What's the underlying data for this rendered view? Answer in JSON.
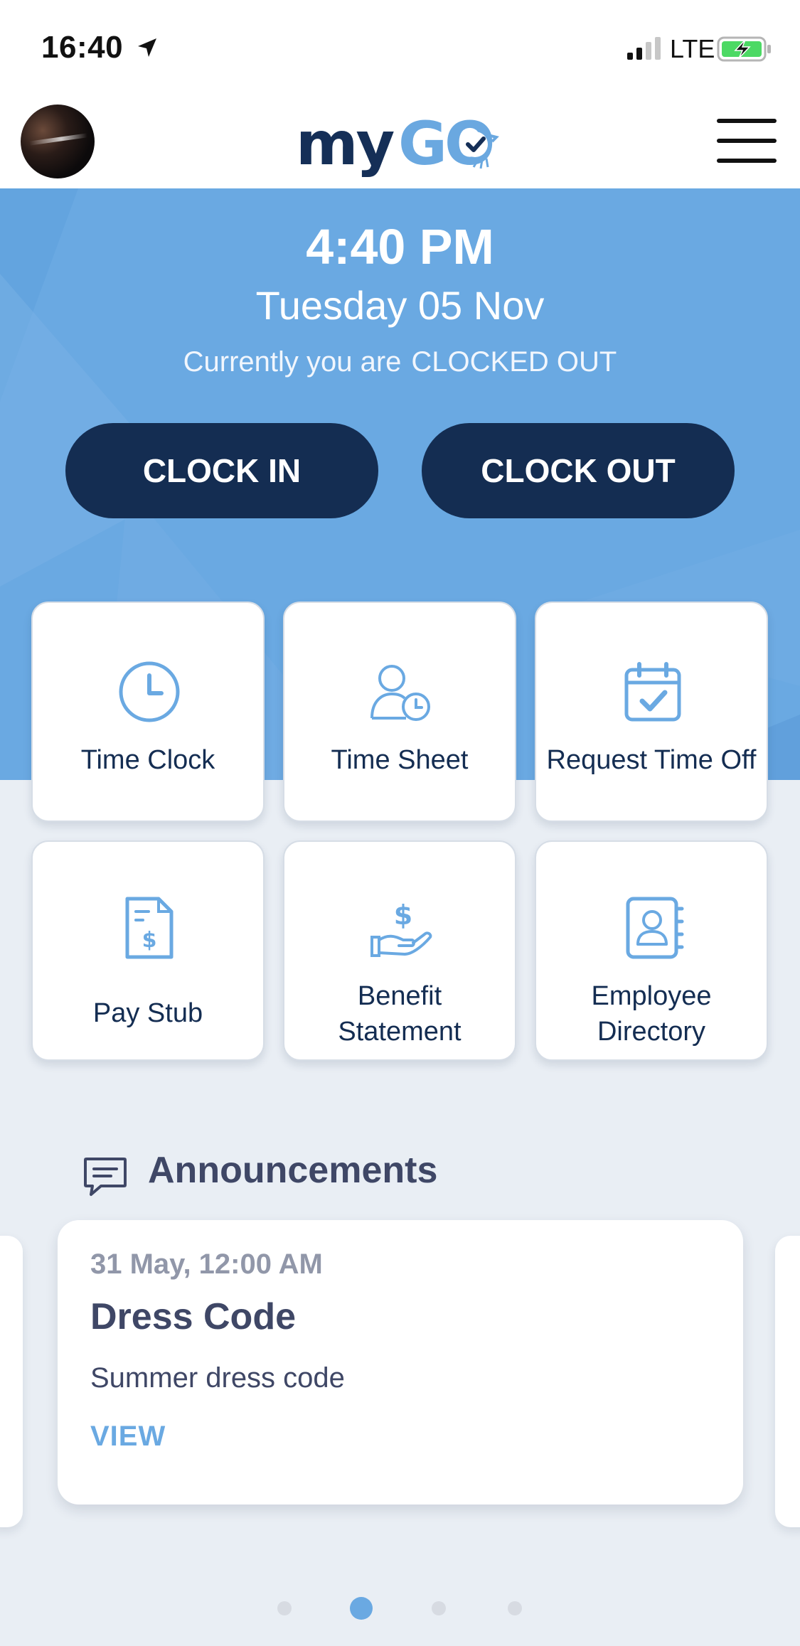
{
  "status_bar": {
    "time": "16:40",
    "network": "LTE",
    "icons": [
      "location-arrow-icon",
      "signal-icon",
      "battery-charging-icon"
    ]
  },
  "header": {
    "logo_part1": "my",
    "logo_part2": "GO",
    "icons": [
      "avatar",
      "hamburger-menu-icon"
    ]
  },
  "hero": {
    "time": "4:40 PM",
    "date": "Tuesday 05 Nov",
    "status_prefix": "Currently you are",
    "status_value": "CLOCKED OUT",
    "clock_in_label": "CLOCK IN",
    "clock_out_label": "CLOCK OUT"
  },
  "tiles": [
    {
      "label": "Time Clock",
      "icon": "clock-icon"
    },
    {
      "label": "Time Sheet",
      "icon": "user-clock-icon"
    },
    {
      "label": "Request Time Off",
      "icon": "calendar-check-icon"
    },
    {
      "label": "Pay Stub",
      "icon": "document-dollar-icon"
    },
    {
      "label_line1": "Benefit",
      "label_line2": "Statement",
      "icon": "hand-dollar-icon"
    },
    {
      "label_line1": "Employee",
      "label_line2": "Directory",
      "icon": "contact-book-icon"
    }
  ],
  "announcements": {
    "heading": "Announcements",
    "icon": "chat-bubble-icon",
    "card": {
      "date": "31 May, 12:00 AM",
      "title": "Dress Code",
      "body": "Summer dress code",
      "action": "VIEW"
    },
    "pager": {
      "total": 4,
      "active_index": 1
    }
  },
  "colors": {
    "primary_dark": "#142d52",
    "accent_blue": "#6aa9e2",
    "background": "#e9eef4",
    "text": "#3f4766"
  }
}
